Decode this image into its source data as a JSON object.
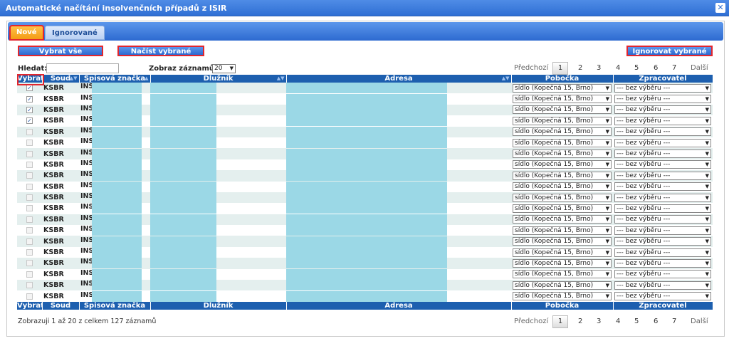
{
  "window": {
    "title": "Automatické načítání insolvenčních případů z ISIR"
  },
  "tabs": {
    "active": "Nové",
    "inactive": "Ignorované"
  },
  "buttons": {
    "select_all": "Vybrat vše",
    "load_selected": "Načíst vybrané",
    "ignore_selected": "Ignorovat vybrané"
  },
  "search": {
    "label": "Hledat:",
    "value": ""
  },
  "length": {
    "label": "Zobraz záznamů:",
    "value": "20"
  },
  "pagination": {
    "prev": "Předchozí",
    "pages": [
      "1",
      "2",
      "3",
      "4",
      "5",
      "6",
      "7"
    ],
    "current": "1",
    "next": "Další"
  },
  "table": {
    "columns": [
      "Vybrat",
      "Soud",
      "Spisová značka",
      "Dlužník",
      "Adresa",
      "Pobočka",
      "Zpracovatel"
    ],
    "rows": [
      {
        "checked": true,
        "court": "KSBR",
        "case": "INS",
        "branch": "sídlo (Kopečná 15, Brno)",
        "processor": "--- bez výběru ---"
      },
      {
        "checked": true,
        "court": "KSBR",
        "case": "INS",
        "branch": "sídlo (Kopečná 15, Brno)",
        "processor": "--- bez výběru ---"
      },
      {
        "checked": true,
        "court": "KSBR",
        "case": "INS",
        "branch": "sídlo (Kopečná 15, Brno)",
        "processor": "--- bez výběru ---"
      },
      {
        "checked": true,
        "court": "KSBR",
        "case": "INS",
        "branch": "sídlo (Kopečná 15, Brno)",
        "processor": "--- bez výběru ---"
      },
      {
        "checked": false,
        "court": "KSBR",
        "case": "INS",
        "branch": "sídlo (Kopečná 15, Brno)",
        "processor": "--- bez výběru ---"
      },
      {
        "checked": false,
        "court": "KSBR",
        "case": "INS",
        "branch": "sídlo (Kopečná 15, Brno)",
        "processor": "--- bez výběru ---"
      },
      {
        "checked": false,
        "court": "KSBR",
        "case": "INS",
        "branch": "sídlo (Kopečná 15, Brno)",
        "processor": "--- bez výběru ---"
      },
      {
        "checked": false,
        "court": "KSBR",
        "case": "INS",
        "branch": "sídlo (Kopečná 15, Brno)",
        "processor": "--- bez výběru ---"
      },
      {
        "checked": false,
        "court": "KSBR",
        "case": "INS",
        "branch": "sídlo (Kopečná 15, Brno)",
        "processor": "--- bez výběru ---"
      },
      {
        "checked": false,
        "court": "KSBR",
        "case": "INS",
        "branch": "sídlo (Kopečná 15, Brno)",
        "processor": "--- bez výběru ---"
      },
      {
        "checked": false,
        "court": "KSBR",
        "case": "INS",
        "branch": "sídlo (Kopečná 15, Brno)",
        "processor": "--- bez výběru ---"
      },
      {
        "checked": false,
        "court": "KSBR",
        "case": "INS",
        "branch": "sídlo (Kopečná 15, Brno)",
        "processor": "--- bez výběru ---"
      },
      {
        "checked": false,
        "court": "KSBR",
        "case": "INS",
        "branch": "sídlo (Kopečná 15, Brno)",
        "processor": "--- bez výběru ---"
      },
      {
        "checked": false,
        "court": "KSBR",
        "case": "INS",
        "branch": "sídlo (Kopečná 15, Brno)",
        "processor": "--- bez výběru ---"
      },
      {
        "checked": false,
        "court": "KSBR",
        "case": "INS",
        "branch": "sídlo (Kopečná 15, Brno)",
        "processor": "--- bez výběru ---"
      },
      {
        "checked": false,
        "court": "KSBR",
        "case": "INS",
        "branch": "sídlo (Kopečná 15, Brno)",
        "processor": "--- bez výběru ---"
      },
      {
        "checked": false,
        "court": "KSBR",
        "case": "INS",
        "branch": "sídlo (Kopečná 15, Brno)",
        "processor": "--- bez výběru ---"
      },
      {
        "checked": false,
        "court": "KSBR",
        "case": "INS",
        "branch": "sídlo (Kopečná 15, Brno)",
        "processor": "--- bez výběru ---"
      },
      {
        "checked": false,
        "court": "KSBR",
        "case": "INS",
        "branch": "sídlo (Kopečná 15, Brno)",
        "processor": "--- bez výběru ---"
      },
      {
        "checked": false,
        "court": "KSBR",
        "case": "INS",
        "branch": "sídlo (Kopečná 15, Brno)",
        "processor": "--- bez výběru ---"
      }
    ]
  },
  "info": "Zobrazuji 1 až 20 z celkem 127 záznamů",
  "icons": {
    "close": "close-icon",
    "sort": "sort-icon",
    "dropdown": "chevron-down-icon",
    "check": "checkmark-icon"
  },
  "colors": {
    "header_blue": "#1d5faf",
    "active_tab": "#f39a12",
    "highlight_red": "#e2262e",
    "redacted_cyan": "#9bd8e6",
    "row_alt": "#e4efee"
  }
}
